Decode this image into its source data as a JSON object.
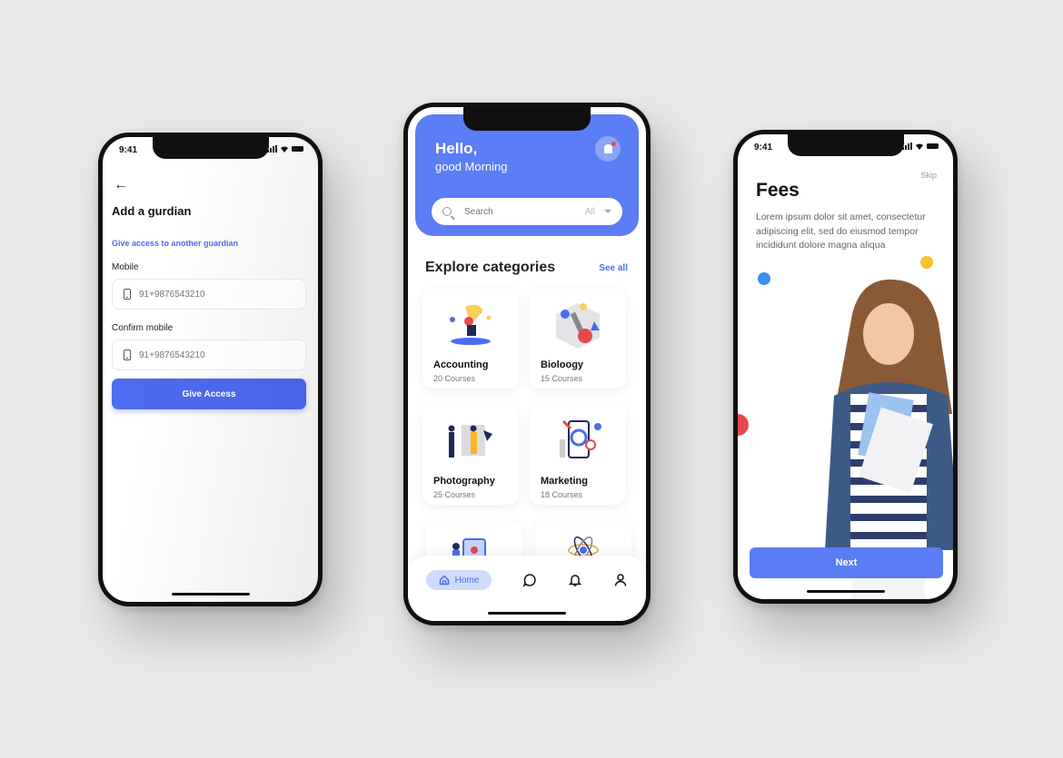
{
  "status": {
    "time": "9:41"
  },
  "guardian_screen": {
    "title": "Add a gurdian",
    "link": "Give access to another guardian",
    "mobile_label": "Mobile",
    "mobile_placeholder": "91+9876543210",
    "confirm_label": "Confirm mobile",
    "confirm_placeholder": "91+9876543210",
    "button_label": "Give Access"
  },
  "home_screen": {
    "hello": "Hello,",
    "greeting": "good Morning",
    "search_placeholder": "Search",
    "search_filter": "All",
    "section_title": "Explore categories",
    "see_all": "See all",
    "categories": [
      {
        "name": "Accounting",
        "count": "20 Courses"
      },
      {
        "name": "Bioloogy",
        "count": "15 Courses"
      },
      {
        "name": "Photography",
        "count": "25 Courses"
      },
      {
        "name": "Marketing",
        "count": "18 Courses"
      }
    ],
    "nav": {
      "home": "Home"
    },
    "colors": {
      "accent": "#5b7df5"
    }
  },
  "fees_screen": {
    "skip": "Skip",
    "title": "Fees",
    "body": "Lorem ipsum dolor sit amet, consectetur adipiscing elit, sed do eiusmod tempor incididunt dolore magna aliqua",
    "button_label": "Next"
  }
}
